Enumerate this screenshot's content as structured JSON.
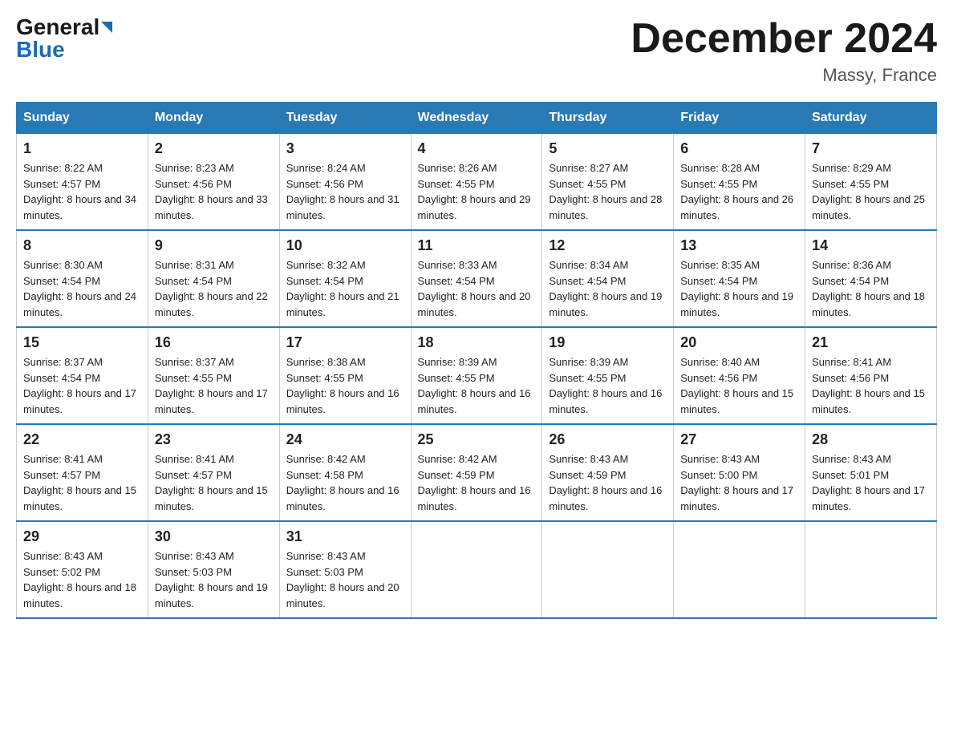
{
  "header": {
    "logo_general": "General",
    "logo_blue": "Blue",
    "month_title": "December 2024",
    "location": "Massy, France"
  },
  "days_of_week": [
    "Sunday",
    "Monday",
    "Tuesday",
    "Wednesday",
    "Thursday",
    "Friday",
    "Saturday"
  ],
  "weeks": [
    [
      {
        "day": "1",
        "sunrise": "8:22 AM",
        "sunset": "4:57 PM",
        "daylight": "8 hours and 34 minutes."
      },
      {
        "day": "2",
        "sunrise": "8:23 AM",
        "sunset": "4:56 PM",
        "daylight": "8 hours and 33 minutes."
      },
      {
        "day": "3",
        "sunrise": "8:24 AM",
        "sunset": "4:56 PM",
        "daylight": "8 hours and 31 minutes."
      },
      {
        "day": "4",
        "sunrise": "8:26 AM",
        "sunset": "4:55 PM",
        "daylight": "8 hours and 29 minutes."
      },
      {
        "day": "5",
        "sunrise": "8:27 AM",
        "sunset": "4:55 PM",
        "daylight": "8 hours and 28 minutes."
      },
      {
        "day": "6",
        "sunrise": "8:28 AM",
        "sunset": "4:55 PM",
        "daylight": "8 hours and 26 minutes."
      },
      {
        "day": "7",
        "sunrise": "8:29 AM",
        "sunset": "4:55 PM",
        "daylight": "8 hours and 25 minutes."
      }
    ],
    [
      {
        "day": "8",
        "sunrise": "8:30 AM",
        "sunset": "4:54 PM",
        "daylight": "8 hours and 24 minutes."
      },
      {
        "day": "9",
        "sunrise": "8:31 AM",
        "sunset": "4:54 PM",
        "daylight": "8 hours and 22 minutes."
      },
      {
        "day": "10",
        "sunrise": "8:32 AM",
        "sunset": "4:54 PM",
        "daylight": "8 hours and 21 minutes."
      },
      {
        "day": "11",
        "sunrise": "8:33 AM",
        "sunset": "4:54 PM",
        "daylight": "8 hours and 20 minutes."
      },
      {
        "day": "12",
        "sunrise": "8:34 AM",
        "sunset": "4:54 PM",
        "daylight": "8 hours and 19 minutes."
      },
      {
        "day": "13",
        "sunrise": "8:35 AM",
        "sunset": "4:54 PM",
        "daylight": "8 hours and 19 minutes."
      },
      {
        "day": "14",
        "sunrise": "8:36 AM",
        "sunset": "4:54 PM",
        "daylight": "8 hours and 18 minutes."
      }
    ],
    [
      {
        "day": "15",
        "sunrise": "8:37 AM",
        "sunset": "4:54 PM",
        "daylight": "8 hours and 17 minutes."
      },
      {
        "day": "16",
        "sunrise": "8:37 AM",
        "sunset": "4:55 PM",
        "daylight": "8 hours and 17 minutes."
      },
      {
        "day": "17",
        "sunrise": "8:38 AM",
        "sunset": "4:55 PM",
        "daylight": "8 hours and 16 minutes."
      },
      {
        "day": "18",
        "sunrise": "8:39 AM",
        "sunset": "4:55 PM",
        "daylight": "8 hours and 16 minutes."
      },
      {
        "day": "19",
        "sunrise": "8:39 AM",
        "sunset": "4:55 PM",
        "daylight": "8 hours and 16 minutes."
      },
      {
        "day": "20",
        "sunrise": "8:40 AM",
        "sunset": "4:56 PM",
        "daylight": "8 hours and 15 minutes."
      },
      {
        "day": "21",
        "sunrise": "8:41 AM",
        "sunset": "4:56 PM",
        "daylight": "8 hours and 15 minutes."
      }
    ],
    [
      {
        "day": "22",
        "sunrise": "8:41 AM",
        "sunset": "4:57 PM",
        "daylight": "8 hours and 15 minutes."
      },
      {
        "day": "23",
        "sunrise": "8:41 AM",
        "sunset": "4:57 PM",
        "daylight": "8 hours and 15 minutes."
      },
      {
        "day": "24",
        "sunrise": "8:42 AM",
        "sunset": "4:58 PM",
        "daylight": "8 hours and 16 minutes."
      },
      {
        "day": "25",
        "sunrise": "8:42 AM",
        "sunset": "4:59 PM",
        "daylight": "8 hours and 16 minutes."
      },
      {
        "day": "26",
        "sunrise": "8:43 AM",
        "sunset": "4:59 PM",
        "daylight": "8 hours and 16 minutes."
      },
      {
        "day": "27",
        "sunrise": "8:43 AM",
        "sunset": "5:00 PM",
        "daylight": "8 hours and 17 minutes."
      },
      {
        "day": "28",
        "sunrise": "8:43 AM",
        "sunset": "5:01 PM",
        "daylight": "8 hours and 17 minutes."
      }
    ],
    [
      {
        "day": "29",
        "sunrise": "8:43 AM",
        "sunset": "5:02 PM",
        "daylight": "8 hours and 18 minutes."
      },
      {
        "day": "30",
        "sunrise": "8:43 AM",
        "sunset": "5:03 PM",
        "daylight": "8 hours and 19 minutes."
      },
      {
        "day": "31",
        "sunrise": "8:43 AM",
        "sunset": "5:03 PM",
        "daylight": "8 hours and 20 minutes."
      },
      null,
      null,
      null,
      null
    ]
  ],
  "labels": {
    "sunrise": "Sunrise: ",
    "sunset": "Sunset: ",
    "daylight": "Daylight: "
  }
}
